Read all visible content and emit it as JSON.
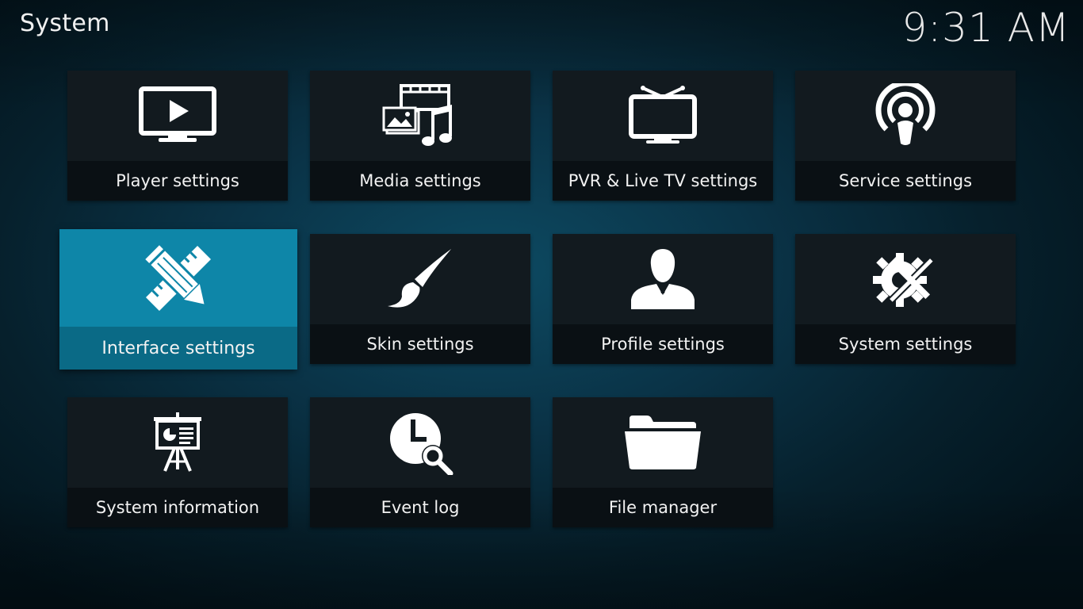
{
  "header": {
    "title": "System",
    "clock": "9:31 AM"
  },
  "tiles": [
    {
      "label": "Player settings",
      "icon": "tv-play-icon"
    },
    {
      "label": "Media settings",
      "icon": "media-icon"
    },
    {
      "label": "PVR & Live TV settings",
      "icon": "live-tv-icon"
    },
    {
      "label": "Service settings",
      "icon": "broadcast-icon"
    },
    {
      "label": "Interface settings",
      "icon": "pencil-ruler-icon",
      "focused": true
    },
    {
      "label": "Skin settings",
      "icon": "paintbrush-icon"
    },
    {
      "label": "Profile settings",
      "icon": "profile-icon"
    },
    {
      "label": "System settings",
      "icon": "gear-tools-icon"
    },
    {
      "label": "System information",
      "icon": "presentation-icon"
    },
    {
      "label": "Event log",
      "icon": "clock-search-icon"
    },
    {
      "label": "File manager",
      "icon": "folder-icon"
    }
  ],
  "colors": {
    "accent": "#0e86a8",
    "tile_bg": "#121a1f",
    "label_bg": "#0a1014"
  }
}
